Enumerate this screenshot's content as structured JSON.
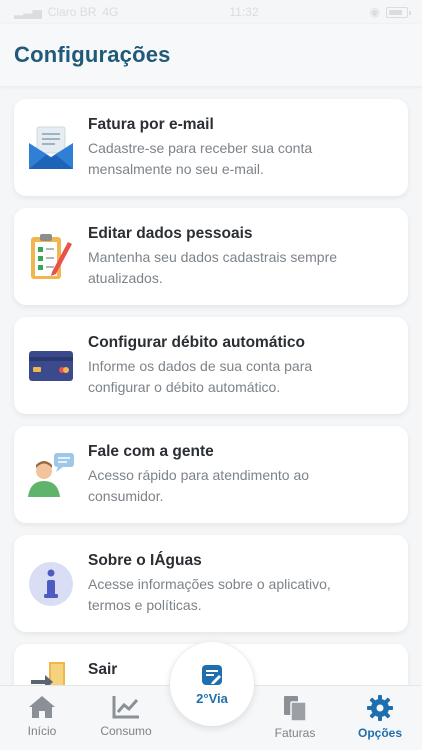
{
  "status_bar": {
    "carrier": "Claro BR",
    "network": "4G",
    "time": "11:32"
  },
  "header": {
    "title": "Configurações"
  },
  "cards": [
    {
      "icon": "email-envelope-icon",
      "title": "Fatura por e-mail",
      "desc1": "Cadastre-se para receber sua conta",
      "desc2": "mensalmente no seu e-mail."
    },
    {
      "icon": "clipboard-checklist-icon",
      "title": "Editar dados pessoais",
      "desc1": "Mantenha seu dados cadastrais sempre",
      "desc2": "atualizados."
    },
    {
      "icon": "credit-card-icon",
      "title": "Configurar débito automático",
      "desc1": "Informe os dados de sua conta para",
      "desc2": "configurar o débito automático."
    },
    {
      "icon": "person-chat-icon",
      "title": "Fale com a gente",
      "desc1": "Acesso rápido para atendimento ao",
      "desc2": "consumidor."
    },
    {
      "icon": "info-circle-icon",
      "title": "Sobre o IÁguas",
      "desc1": "Acesse informações sobre o aplicativo,",
      "desc2": "termos e políticas."
    },
    {
      "icon": "exit-door-icon",
      "title": "Sair",
      "desc1": "",
      "desc2": ""
    }
  ],
  "tabbar": {
    "inicio": "Início",
    "consumo": "Consumo",
    "segunda_via": "2°Via",
    "faturas": "Faturas",
    "opcoes": "Opções"
  },
  "colors": {
    "accent": "#1f6fae",
    "title": "#215a78"
  }
}
